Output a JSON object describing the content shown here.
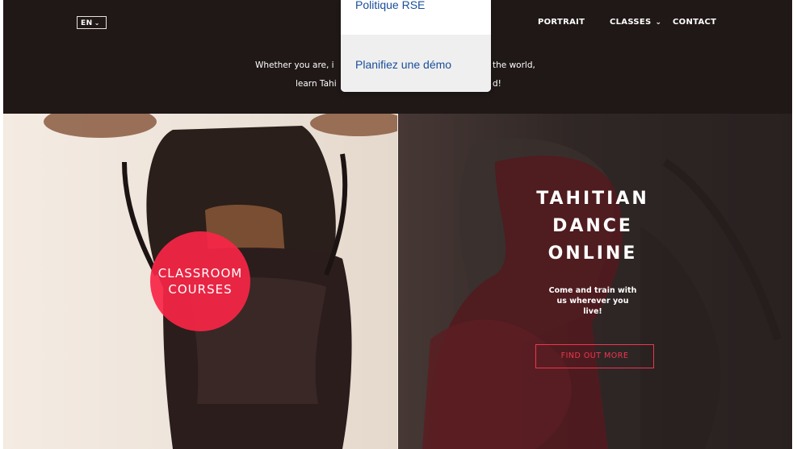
{
  "header": {
    "language": "EN",
    "nav": {
      "portrait": "PORTRAIT",
      "classes": "CLASSES",
      "contact": "CONTACT"
    },
    "intro": {
      "line1_left": "Whether you are, i",
      "line1_right": "the world,",
      "line2_left": "learn Tahi",
      "line2_right": "d!"
    }
  },
  "dropdown": {
    "items": [
      "Politique RSE",
      "Planifiez une démo"
    ],
    "hovered_item": "Planifiez une démo"
  },
  "left_panel": {
    "badge_line1": "CLASSROOM",
    "badge_line2": "COURSES"
  },
  "right_panel": {
    "title_line1": "TAHITIAN",
    "title_line2": "DANCE",
    "title_line3": "ONLINE",
    "subtitle_line1": "Come and train with",
    "subtitle_line2": "us wherever you",
    "subtitle_line3": "live!",
    "cta": "FIND OUT MORE"
  },
  "colors": {
    "header_bg": "#1f1817",
    "accent": "#f82547",
    "cta_border": "#ef3550",
    "dropdown_text": "#1a4e9a",
    "dropdown_hover_bg": "#efefef"
  },
  "icons": [
    "chevron-down-icon"
  ]
}
